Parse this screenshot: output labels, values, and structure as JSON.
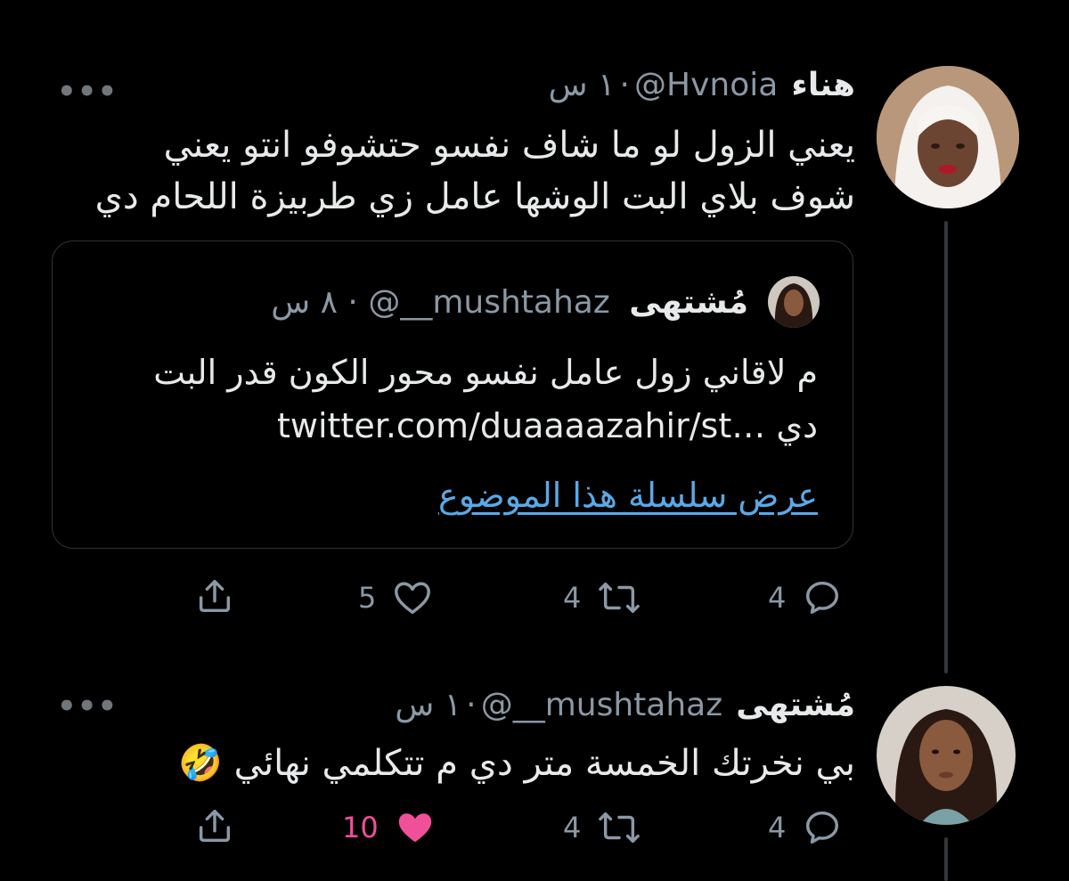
{
  "tweet1": {
    "name": "هناء",
    "handle": "@Hvnoia",
    "separator": "·",
    "time": "١ س",
    "text_line1": "يعني الزول لو ما شاف نفسو حتشوفو انتو يعني",
    "text_line2": "شوف بلاي البت الوشها عامل زي طربيزة اللحام دي",
    "quoted": {
      "name": "مُشتهى",
      "handle": "@__mushtahaz",
      "separator": "·",
      "time": "٨ س",
      "text_line1": "م لاقاني زول عامل نفسو محور الكون قدر البت",
      "text_line2_link": "twitter.com/duaaaazahir/st…",
      "text_line2_word": "دي",
      "thread_link": "عرض سلسلة هذا الموضوع"
    },
    "replies": "4",
    "retweets": "4",
    "likes": "5",
    "icons": [
      "reply-icon",
      "retweet-icon",
      "like-icon",
      "share-icon",
      "more-icon"
    ]
  },
  "tweet2": {
    "name": "مُشتهى",
    "handle": "@__mushtahaz",
    "separator": "·",
    "time": "١ س",
    "text": "بي نخرتك الخمسة متر دي م تتكلمي نهائي 🤣",
    "replies": "4",
    "retweets": "4",
    "likes": "10",
    "liked": true,
    "icons": [
      "reply-icon",
      "retweet-icon",
      "like-filled-icon",
      "share-icon",
      "more-icon"
    ]
  },
  "more_label": "•••",
  "colors": {
    "background": "#000000",
    "text": "#e7e9ea",
    "secondary": "#8b98a5",
    "link": "#5aa9e6",
    "like_active": "#f0509a",
    "thread_line": "#333639"
  }
}
